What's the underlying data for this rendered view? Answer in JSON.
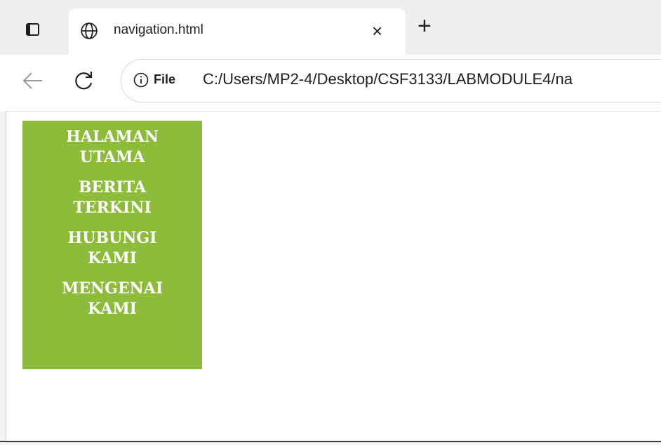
{
  "tab": {
    "title": "navigation.html",
    "close_glyph": "×",
    "new_tab_glyph": "+",
    "icon": "globe-icon"
  },
  "toolbar": {
    "back_icon": "back-arrow-icon",
    "reload_icon": "reload-icon",
    "info_icon": "info-icon",
    "scheme_label": "File",
    "url": "C:/Users/MP2-4/Desktop/CSF3133/LABMODULE4/na"
  },
  "nav": {
    "background": "#8cbc3a",
    "text_color": "#ffffff",
    "items": [
      {
        "label": "HALAMAN\nUTAMA"
      },
      {
        "label": "BERITA\nTERKINI"
      },
      {
        "label": "HUBUNGI\nKAMI"
      },
      {
        "label": "MENGENAI\nKAMI"
      }
    ]
  }
}
